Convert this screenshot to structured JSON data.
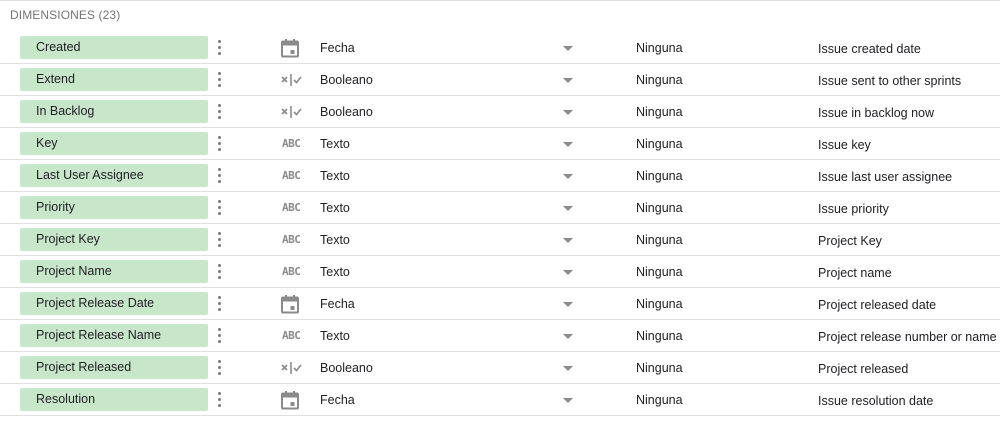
{
  "section": {
    "title": "DIMENSIONES (23)"
  },
  "rows": [
    {
      "name": "Created",
      "type": "date",
      "type_label": "Fecha",
      "aggregation": "Ninguna",
      "description": "Issue created date"
    },
    {
      "name": "Extend",
      "type": "boolean",
      "type_label": "Booleano",
      "aggregation": "Ninguna",
      "description": "Issue sent to other sprints"
    },
    {
      "name": "In Backlog",
      "type": "boolean",
      "type_label": "Booleano",
      "aggregation": "Ninguna",
      "description": "Issue in backlog now"
    },
    {
      "name": "Key",
      "type": "text",
      "type_label": "Texto",
      "aggregation": "Ninguna",
      "description": "Issue key"
    },
    {
      "name": "Last User Assignee",
      "type": "text",
      "type_label": "Texto",
      "aggregation": "Ninguna",
      "description": "Issue last user assignee"
    },
    {
      "name": "Priority",
      "type": "text",
      "type_label": "Texto",
      "aggregation": "Ninguna",
      "description": "Issue priority"
    },
    {
      "name": "Project Key",
      "type": "text",
      "type_label": "Texto",
      "aggregation": "Ninguna",
      "description": "Project Key"
    },
    {
      "name": "Project Name",
      "type": "text",
      "type_label": "Texto",
      "aggregation": "Ninguna",
      "description": "Project name"
    },
    {
      "name": "Project Release Date",
      "type": "date",
      "type_label": "Fecha",
      "aggregation": "Ninguna",
      "description": "Project released date"
    },
    {
      "name": "Project Release Name",
      "type": "text",
      "type_label": "Texto",
      "aggregation": "Ninguna",
      "description": "Project release number or name"
    },
    {
      "name": "Project Released",
      "type": "boolean",
      "type_label": "Booleano",
      "aggregation": "Ninguna",
      "description": "Project released"
    },
    {
      "name": "Resolution",
      "type": "date",
      "type_label": "Fecha",
      "aggregation": "Ninguna",
      "description": "Issue resolution date"
    }
  ],
  "icons": {
    "date": "calendar-icon",
    "boolean": "boolean-icon",
    "text": "text-abc-icon",
    "text_glyph": "ABC"
  },
  "colors": {
    "chip_background": "#c8e6c9",
    "icon_gray": "#8a8a8a",
    "divider": "#e0e0e0"
  }
}
